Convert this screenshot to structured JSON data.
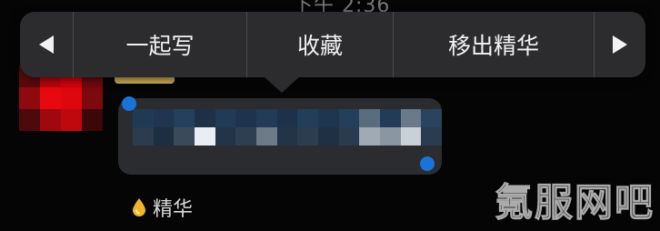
{
  "status_bar": {
    "time": "下午 2:36"
  },
  "context_menu": {
    "items": [
      {
        "label": "一起写"
      },
      {
        "label": "收藏"
      },
      {
        "label": "移出精华"
      }
    ]
  },
  "message": {
    "tag_label": "精华"
  },
  "watermark": {
    "text": "氪服网吧"
  },
  "colors": {
    "menu_bg": "#2c2c2e",
    "bubble_bg": "#2a2c30",
    "selection_handle": "#1a73d9",
    "essence_drop": "#f0b429"
  }
}
